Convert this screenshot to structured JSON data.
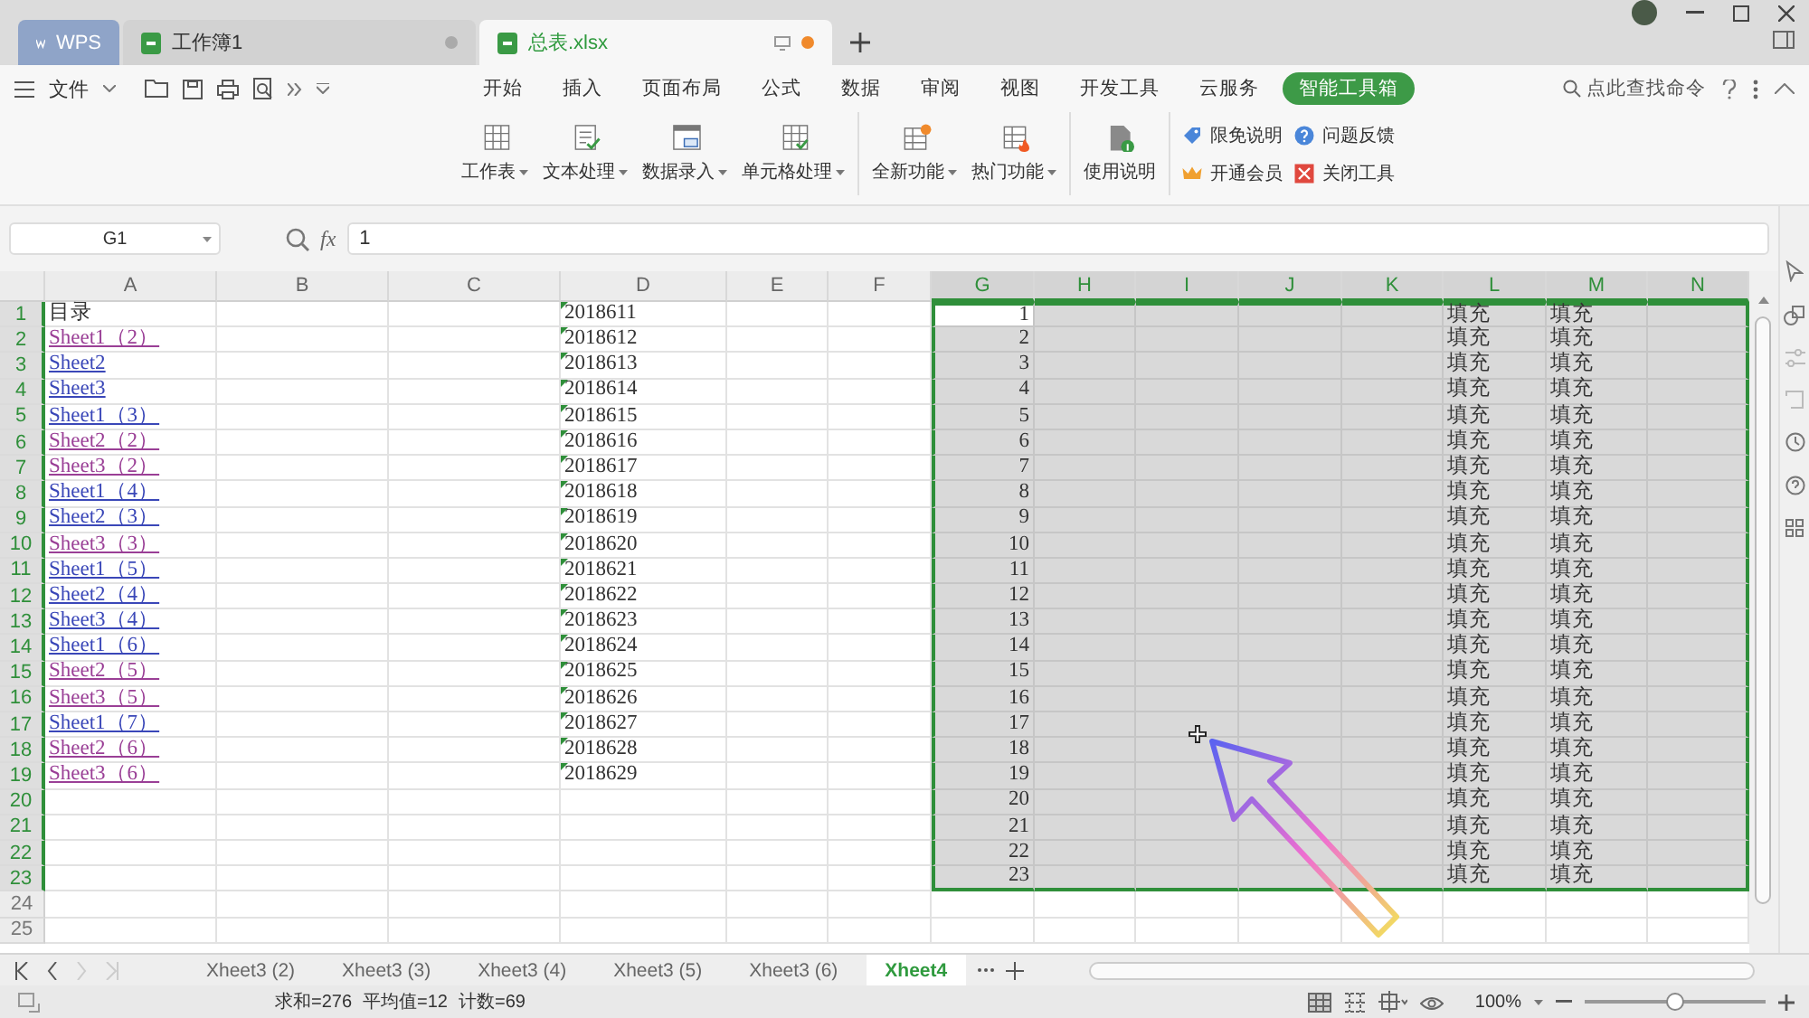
{
  "title_bar": {
    "tabs": [
      {
        "label": "WPS",
        "kind": "app",
        "selected": false
      },
      {
        "label": "工作簿1",
        "kind": "doc",
        "selected": false,
        "modified": false
      },
      {
        "label": "总表.xlsx",
        "kind": "doc",
        "selected": true,
        "modified": true
      }
    ]
  },
  "menu": {
    "file": "文件",
    "tabs": [
      {
        "label": "开始",
        "selected": false
      },
      {
        "label": "插入",
        "selected": false
      },
      {
        "label": "页面布局",
        "selected": false
      },
      {
        "label": "公式",
        "selected": false
      },
      {
        "label": "数据",
        "selected": false
      },
      {
        "label": "审阅",
        "selected": false
      },
      {
        "label": "视图",
        "selected": false
      },
      {
        "label": "开发工具",
        "selected": false
      },
      {
        "label": "云服务",
        "selected": false
      },
      {
        "label": "智能工具箱",
        "selected": true
      }
    ],
    "search_placeholder": "点此查找命令"
  },
  "ribbon": {
    "groups": [
      [
        {
          "label": "工作表",
          "dropdown": true
        },
        {
          "label": "文本处理",
          "dropdown": true
        },
        {
          "label": "数据录入",
          "dropdown": true
        },
        {
          "label": "单元格处理",
          "dropdown": true
        }
      ],
      [
        {
          "label": "全新功能",
          "dropdown": true
        },
        {
          "label": "热门功能",
          "dropdown": true
        }
      ],
      [
        {
          "label": "使用说明",
          "dropdown": false
        }
      ]
    ],
    "small_buttons": [
      {
        "label": "限免说明"
      },
      {
        "label": "问题反馈"
      },
      {
        "label": "开通会员"
      },
      {
        "label": "关闭工具"
      }
    ]
  },
  "formula_bar": {
    "name_box": "G1",
    "fx": "fx",
    "value": "1"
  },
  "sheet": {
    "columns": [
      {
        "label": "A",
        "selected": false
      },
      {
        "label": "B",
        "selected": false
      },
      {
        "label": "C",
        "selected": false
      },
      {
        "label": "D",
        "selected": false
      },
      {
        "label": "E",
        "selected": false
      },
      {
        "label": "F",
        "selected": false
      },
      {
        "label": "G",
        "selected": true
      },
      {
        "label": "H",
        "selected": true
      },
      {
        "label": "I",
        "selected": true
      },
      {
        "label": "J",
        "selected": true
      },
      {
        "label": "K",
        "selected": true
      },
      {
        "label": "L",
        "selected": true
      },
      {
        "label": "M",
        "selected": true
      },
      {
        "label": "N",
        "selected": true
      }
    ],
    "rows": [
      {
        "label": "1",
        "selected": true,
        "cells": {
          "A": {
            "text": "目录",
            "kind": "text"
          },
          "D": {
            "text": "2018611",
            "kind": "text_number"
          },
          "G": {
            "text": "1",
            "kind": "number",
            "active": true
          },
          "L": {
            "text": "填充",
            "kind": "text"
          },
          "M": {
            "text": "填充",
            "kind": "text"
          }
        }
      },
      {
        "label": "2",
        "selected": true,
        "cells": {
          "A": {
            "text": "Sheet1（2）",
            "kind": "link",
            "visited": true
          },
          "D": {
            "text": "2018612",
            "kind": "text_number"
          },
          "G": {
            "text": "2",
            "kind": "number",
            "active": false
          },
          "L": {
            "text": "填充",
            "kind": "text"
          },
          "M": {
            "text": "填充",
            "kind": "text"
          }
        }
      },
      {
        "label": "3",
        "selected": true,
        "cells": {
          "A": {
            "text": "Sheet2",
            "kind": "link",
            "visited": false
          },
          "D": {
            "text": "2018613",
            "kind": "text_number"
          },
          "G": {
            "text": "3",
            "kind": "number",
            "active": false
          },
          "L": {
            "text": "填充",
            "kind": "text"
          },
          "M": {
            "text": "填充",
            "kind": "text"
          }
        }
      },
      {
        "label": "4",
        "selected": true,
        "cells": {
          "A": {
            "text": "Sheet3",
            "kind": "link",
            "visited": false
          },
          "D": {
            "text": "2018614",
            "kind": "text_number"
          },
          "G": {
            "text": "4",
            "kind": "number",
            "active": false
          },
          "L": {
            "text": "填充",
            "kind": "text"
          },
          "M": {
            "text": "填充",
            "kind": "text"
          }
        }
      },
      {
        "label": "5",
        "selected": true,
        "cells": {
          "A": {
            "text": "Sheet1（3）",
            "kind": "link",
            "visited": false
          },
          "D": {
            "text": "2018615",
            "kind": "text_number"
          },
          "G": {
            "text": "5",
            "kind": "number",
            "active": false
          },
          "L": {
            "text": "填充",
            "kind": "text"
          },
          "M": {
            "text": "填充",
            "kind": "text"
          }
        }
      },
      {
        "label": "6",
        "selected": true,
        "cells": {
          "A": {
            "text": "Sheet2（2）",
            "kind": "link",
            "visited": true
          },
          "D": {
            "text": "2018616",
            "kind": "text_number"
          },
          "G": {
            "text": "6",
            "kind": "number",
            "active": false
          },
          "L": {
            "text": "填充",
            "kind": "text"
          },
          "M": {
            "text": "填充",
            "kind": "text"
          }
        }
      },
      {
        "label": "7",
        "selected": true,
        "cells": {
          "A": {
            "text": "Sheet3（2）",
            "kind": "link",
            "visited": true
          },
          "D": {
            "text": "2018617",
            "kind": "text_number"
          },
          "G": {
            "text": "7",
            "kind": "number",
            "active": false
          },
          "L": {
            "text": "填充",
            "kind": "text"
          },
          "M": {
            "text": "填充",
            "kind": "text"
          }
        }
      },
      {
        "label": "8",
        "selected": true,
        "cells": {
          "A": {
            "text": "Sheet1（4）",
            "kind": "link",
            "visited": false
          },
          "D": {
            "text": "2018618",
            "kind": "text_number"
          },
          "G": {
            "text": "8",
            "kind": "number",
            "active": false
          },
          "L": {
            "text": "填充",
            "kind": "text"
          },
          "M": {
            "text": "填充",
            "kind": "text"
          }
        }
      },
      {
        "label": "9",
        "selected": true,
        "cells": {
          "A": {
            "text": "Sheet2（3）",
            "kind": "link",
            "visited": false
          },
          "D": {
            "text": "2018619",
            "kind": "text_number"
          },
          "G": {
            "text": "9",
            "kind": "number",
            "active": false
          },
          "L": {
            "text": "填充",
            "kind": "text"
          },
          "M": {
            "text": "填充",
            "kind": "text"
          }
        }
      },
      {
        "label": "10",
        "selected": true,
        "cells": {
          "A": {
            "text": "Sheet3（3）",
            "kind": "link",
            "visited": true
          },
          "D": {
            "text": "2018620",
            "kind": "text_number"
          },
          "G": {
            "text": "10",
            "kind": "number",
            "active": false
          },
          "L": {
            "text": "填充",
            "kind": "text"
          },
          "M": {
            "text": "填充",
            "kind": "text"
          }
        }
      },
      {
        "label": "11",
        "selected": true,
        "cells": {
          "A": {
            "text": "Sheet1（5）",
            "kind": "link",
            "visited": false
          },
          "D": {
            "text": "2018621",
            "kind": "text_number"
          },
          "G": {
            "text": "11",
            "kind": "number",
            "active": false
          },
          "L": {
            "text": "填充",
            "kind": "text"
          },
          "M": {
            "text": "填充",
            "kind": "text"
          }
        }
      },
      {
        "label": "12",
        "selected": true,
        "cells": {
          "A": {
            "text": "Sheet2（4）",
            "kind": "link",
            "visited": false
          },
          "D": {
            "text": "2018622",
            "kind": "text_number"
          },
          "G": {
            "text": "12",
            "kind": "number",
            "active": false
          },
          "L": {
            "text": "填充",
            "kind": "text"
          },
          "M": {
            "text": "填充",
            "kind": "text"
          }
        }
      },
      {
        "label": "13",
        "selected": true,
        "cells": {
          "A": {
            "text": "Sheet3（4）",
            "kind": "link",
            "visited": false
          },
          "D": {
            "text": "2018623",
            "kind": "text_number"
          },
          "G": {
            "text": "13",
            "kind": "number",
            "active": false
          },
          "L": {
            "text": "填充",
            "kind": "text"
          },
          "M": {
            "text": "填充",
            "kind": "text"
          }
        }
      },
      {
        "label": "14",
        "selected": true,
        "cells": {
          "A": {
            "text": "Sheet1（6）",
            "kind": "link",
            "visited": false
          },
          "D": {
            "text": "2018624",
            "kind": "text_number"
          },
          "G": {
            "text": "14",
            "kind": "number",
            "active": false
          },
          "L": {
            "text": "填充",
            "kind": "text"
          },
          "M": {
            "text": "填充",
            "kind": "text"
          }
        }
      },
      {
        "label": "15",
        "selected": true,
        "cells": {
          "A": {
            "text": "Sheet2（5）",
            "kind": "link",
            "visited": true
          },
          "D": {
            "text": "2018625",
            "kind": "text_number"
          },
          "G": {
            "text": "15",
            "kind": "number",
            "active": false
          },
          "L": {
            "text": "填充",
            "kind": "text"
          },
          "M": {
            "text": "填充",
            "kind": "text"
          }
        }
      },
      {
        "label": "16",
        "selected": true,
        "cells": {
          "A": {
            "text": "Sheet3（5）",
            "kind": "link",
            "visited": true
          },
          "D": {
            "text": "2018626",
            "kind": "text_number"
          },
          "G": {
            "text": "16",
            "kind": "number",
            "active": false
          },
          "L": {
            "text": "填充",
            "kind": "text"
          },
          "M": {
            "text": "填充",
            "kind": "text"
          }
        }
      },
      {
        "label": "17",
        "selected": true,
        "cells": {
          "A": {
            "text": "Sheet1（7）",
            "kind": "link",
            "visited": false
          },
          "D": {
            "text": "2018627",
            "kind": "text_number"
          },
          "G": {
            "text": "17",
            "kind": "number",
            "active": false
          },
          "L": {
            "text": "填充",
            "kind": "text"
          },
          "M": {
            "text": "填充",
            "kind": "text"
          }
        }
      },
      {
        "label": "18",
        "selected": true,
        "cells": {
          "A": {
            "text": "Sheet2（6）",
            "kind": "link",
            "visited": true
          },
          "D": {
            "text": "2018628",
            "kind": "text_number"
          },
          "G": {
            "text": "18",
            "kind": "number",
            "active": false
          },
          "L": {
            "text": "填充",
            "kind": "text"
          },
          "M": {
            "text": "填充",
            "kind": "text"
          }
        }
      },
      {
        "label": "19",
        "selected": true,
        "cells": {
          "A": {
            "text": "Sheet3（6）",
            "kind": "link",
            "visited": true
          },
          "D": {
            "text": "2018629",
            "kind": "text_number"
          },
          "G": {
            "text": "19",
            "kind": "number",
            "active": false
          },
          "L": {
            "text": "填充",
            "kind": "text"
          },
          "M": {
            "text": "填充",
            "kind": "text"
          }
        }
      },
      {
        "label": "20",
        "selected": true,
        "cells": {
          "G": {
            "text": "20",
            "kind": "number",
            "active": false
          },
          "L": {
            "text": "填充",
            "kind": "text"
          },
          "M": {
            "text": "填充",
            "kind": "text"
          }
        }
      },
      {
        "label": "21",
        "selected": true,
        "cells": {
          "G": {
            "text": "21",
            "kind": "number",
            "active": false
          },
          "L": {
            "text": "填充",
            "kind": "text"
          },
          "M": {
            "text": "填充",
            "kind": "text"
          }
        }
      },
      {
        "label": "22",
        "selected": true,
        "cells": {
          "G": {
            "text": "22",
            "kind": "number",
            "active": false
          },
          "L": {
            "text": "填充",
            "kind": "text"
          },
          "M": {
            "text": "填充",
            "kind": "text"
          }
        }
      },
      {
        "label": "23",
        "selected": true,
        "cells": {
          "G": {
            "text": "23",
            "kind": "number",
            "active": false
          },
          "L": {
            "text": "填充",
            "kind": "text"
          },
          "M": {
            "text": "填充",
            "kind": "text"
          }
        }
      },
      {
        "label": "24",
        "selected": false,
        "cells": {}
      },
      {
        "label": "25",
        "selected": false,
        "cells": {}
      }
    ]
  },
  "sheet_tabs": [
    {
      "label": "Xheet3 (2)",
      "selected": false
    },
    {
      "label": "Xheet3 (3)",
      "selected": false
    },
    {
      "label": "Xheet3 (4)",
      "selected": false
    },
    {
      "label": "Xheet3 (5)",
      "selected": false
    },
    {
      "label": "Xheet3 (6)",
      "selected": false
    },
    {
      "label": "Xheet4",
      "selected": true
    }
  ],
  "status_bar": {
    "stats": [
      "求和=276",
      "平均值=12",
      "计数=69"
    ],
    "zoom": "100%",
    "zoom_slider": {
      "level": 0.5
    }
  }
}
